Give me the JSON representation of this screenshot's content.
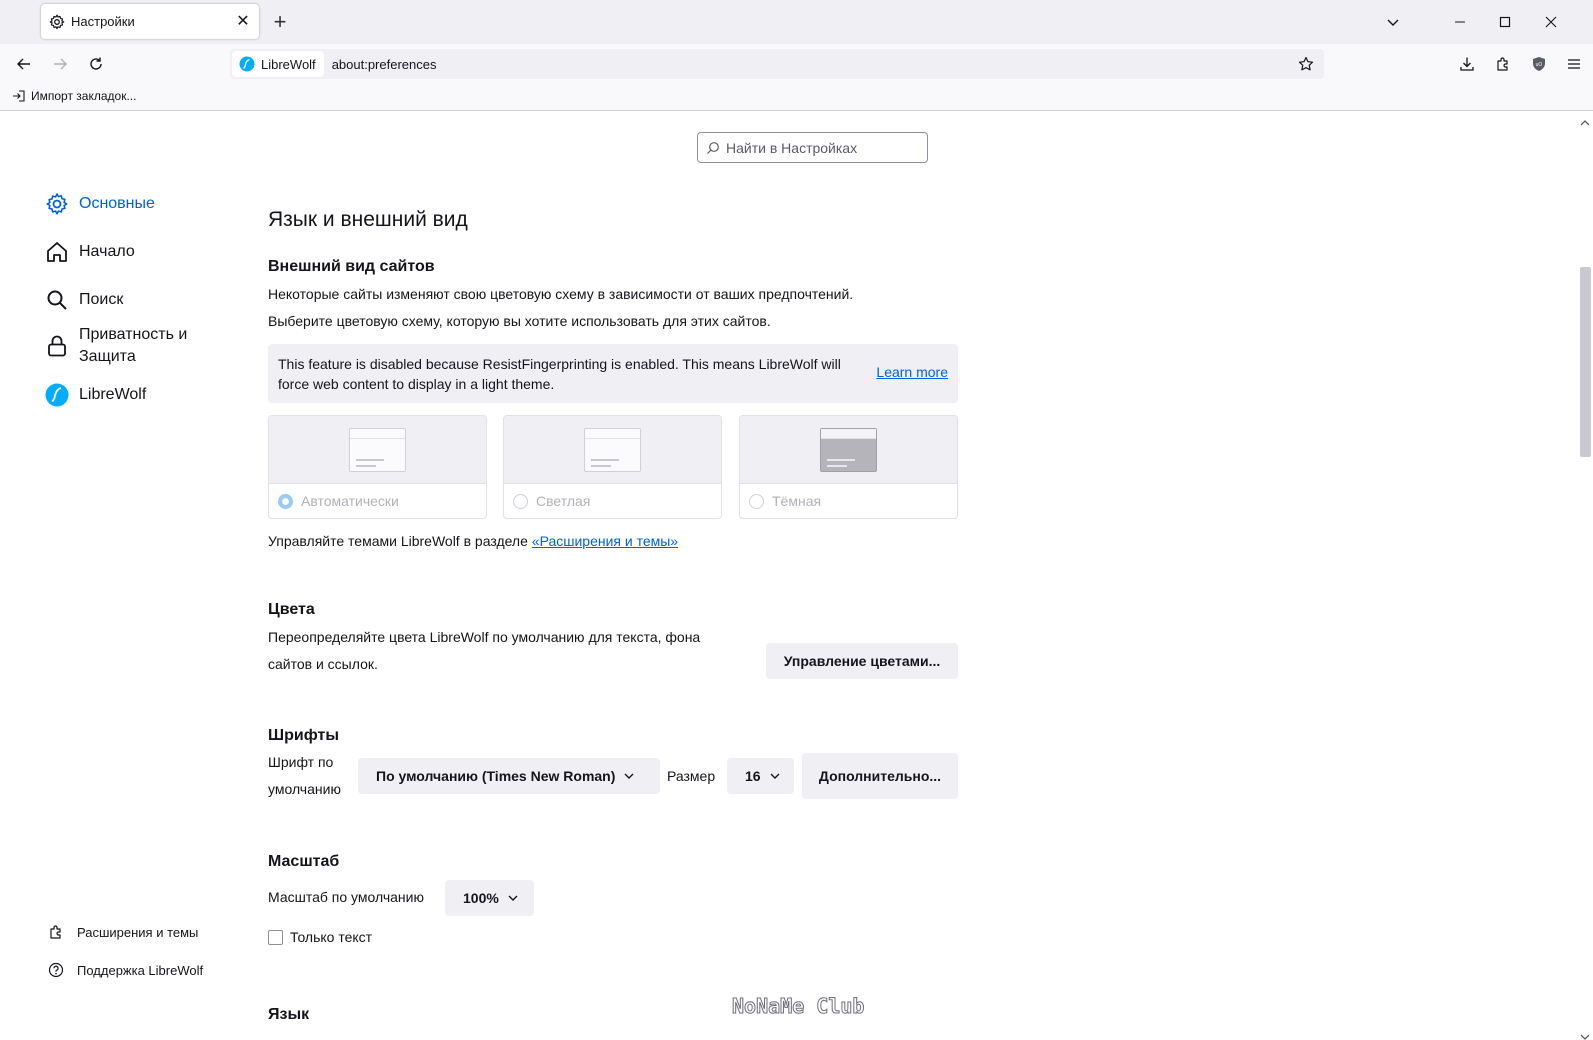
{
  "tab": {
    "title": "Настройки",
    "close": "✕"
  },
  "tabstrip": {
    "new_tab": "+"
  },
  "navbar": {
    "identity_label": "LibreWolf",
    "url": "about:preferences"
  },
  "bookmarks": {
    "import_label": "Импорт закладок..."
  },
  "search": {
    "placeholder": "Найти в Настройках"
  },
  "sidebar": {
    "categories": [
      {
        "label": "Основные",
        "icon": "gear-icon",
        "selected": true
      },
      {
        "label": "Начало",
        "icon": "home-icon"
      },
      {
        "label": "Поиск",
        "icon": "search-icon"
      },
      {
        "label_line1": "Приватность и",
        "label_line2": "Защита",
        "icon": "lock-icon"
      },
      {
        "label": "LibreWolf",
        "icon": "librewolf-icon"
      }
    ],
    "footer": {
      "extensions": "Расширения и темы",
      "support": "Поддержка LibreWolf"
    }
  },
  "main": {
    "section_title": "Язык и внешний вид",
    "appearance": {
      "heading": "Внешний вид сайтов",
      "desc1": "Некоторые сайты изменяют свою цветовую схему в зависимости от ваших предпочтений.",
      "desc2": "Выберите цветовую схему, которую вы хотите использовать для этих сайтов.",
      "notice_text": "This feature is disabled because ResistFingerprinting is enabled. This means LibreWolf will force web content to display in a light theme.",
      "notice_link": "Learn more",
      "schemes": [
        "Автоматически",
        "Светлая",
        "Тёмная"
      ],
      "manage_prefix": "Управляйте темами LibreWolf в разделе ",
      "manage_link": "«Расширения и темы»"
    },
    "colors": {
      "heading": "Цвета",
      "desc1": "Переопределяйте цвета LibreWolf по умолчанию для текста, фона",
      "desc2": "сайтов и ссылок.",
      "button": "Управление цветами..."
    },
    "fonts": {
      "heading": "Шрифты",
      "default_label_1": "Шрифт по",
      "default_label_2": "умолчанию",
      "default_font": "По умолчанию (Times New Roman)",
      "size_label": "Размер",
      "size_value": "16",
      "advanced_button": "Дополнительно..."
    },
    "zoom": {
      "heading": "Масштаб",
      "default_label": "Масштаб по умолчанию",
      "default_value": "100%",
      "text_only": "Только текст"
    },
    "language": {
      "heading": "Язык"
    }
  },
  "watermark": "NoNaMe Club",
  "colors": {
    "accent": "#0061e0",
    "link": "#0061e0",
    "tab_bg": "#f0f0f4"
  }
}
